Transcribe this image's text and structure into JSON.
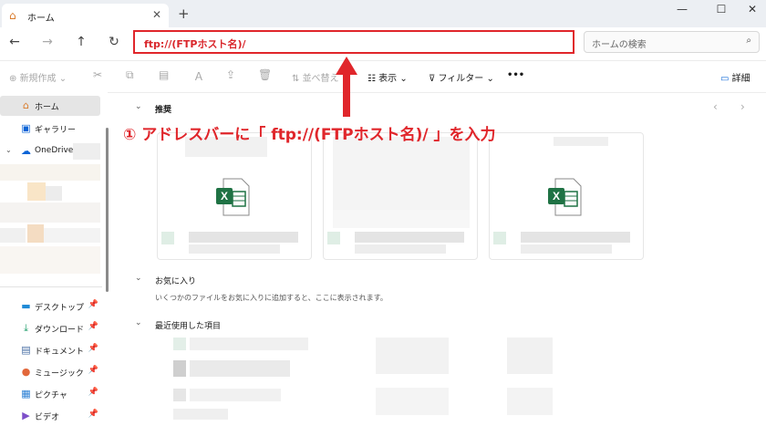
{
  "window": {
    "tab_title": "ホーム",
    "new_tab": "+",
    "tab_close": "✕",
    "minimize": "—",
    "maximize": "☐",
    "close": "✕"
  },
  "nav": {
    "back": "←",
    "forward": "→",
    "up": "↑",
    "refresh": "↻"
  },
  "address": {
    "value": "ftp://(FTPホスト名)/"
  },
  "search": {
    "placeholder": "ホームの検索"
  },
  "toolbar": {
    "new": "新規作成",
    "sort": "並べ替え",
    "view": "表示",
    "filter": "フィルター",
    "more": "•••",
    "details": "詳細"
  },
  "sidebar": {
    "home": "ホーム",
    "gallery": "ギャラリー",
    "onedrive": "OneDrive",
    "desktop": "デスクトップ",
    "downloads": "ダウンロード",
    "documents": "ドキュメント",
    "music": "ミュージック",
    "pictures": "ピクチャ",
    "videos": "ビデオ"
  },
  "sections": {
    "recommended": "推奨",
    "favorites": "お気に入り",
    "favorites_hint": "いくつかのファイルをお気に入りに追加すると、ここに表示されます。",
    "recent": "最近使用した項目"
  },
  "annotation": "① アドレスバーに「 ftp://(FTPホスト名)/ 」を入力",
  "colors": {
    "accent_red": "#e0262b",
    "excel_green": "#1f7244",
    "onedrive_blue": "#0a64d6"
  }
}
